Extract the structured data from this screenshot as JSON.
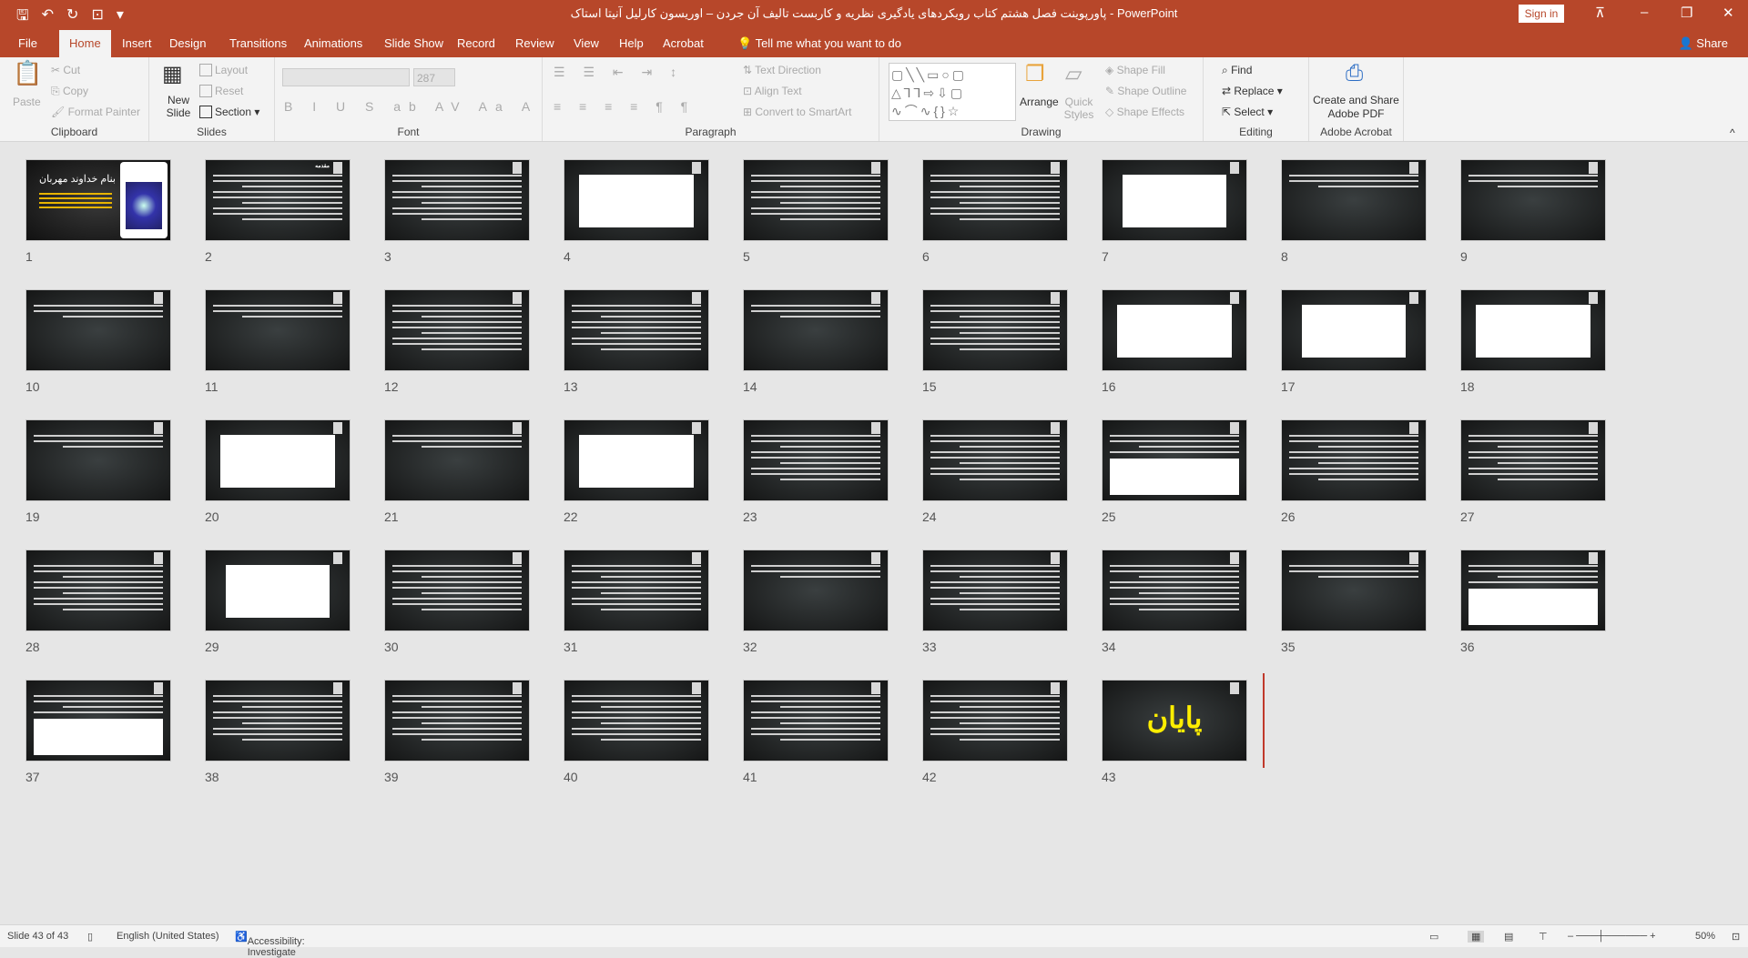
{
  "app": {
    "title": "پاورپوینت فصل هشتم کتاب رویکردهای یادگیری نظریه و کاربست تالیف آن جردن – اوریسون کارلیل آنیتا استاک  -  PowerPoint",
    "sign_in": "Sign in",
    "accent": "#b7472a"
  },
  "tabs": [
    "File",
    "Home",
    "Insert",
    "Design",
    "Transitions",
    "Animations",
    "Slide Show",
    "Record",
    "Review",
    "View",
    "Help",
    "Acrobat"
  ],
  "active_tab": "Home",
  "tell_me": "Tell me what you want to do",
  "share": "Share",
  "ribbon": {
    "clipboard": {
      "label": "Clipboard",
      "paste": "Paste",
      "cut": "Cut",
      "copy": "Copy",
      "format_painter": "Format Painter"
    },
    "slides": {
      "label": "Slides",
      "new_slide": "New Slide",
      "layout": "Layout",
      "reset": "Reset",
      "section": "Section"
    },
    "font": {
      "label": "Font",
      "font_size": "287"
    },
    "paragraph": {
      "label": "Paragraph",
      "text_direction": "Text Direction",
      "align_text": "Align Text",
      "convert": "Convert to SmartArt"
    },
    "drawing": {
      "label": "Drawing",
      "arrange": "Arrange",
      "quick_styles": "Quick Styles",
      "shape_fill": "Shape Fill",
      "shape_outline": "Shape Outline",
      "shape_effects": "Shape Effects"
    },
    "editing": {
      "label": "Editing",
      "find": "Find",
      "replace": "Replace",
      "select": "Select"
    },
    "acrobat": {
      "label": "Adobe Acrobat",
      "create": "Create and Share Adobe PDF"
    }
  },
  "slides": [
    {
      "n": "1",
      "kind": "title",
      "title": "بنام خداوند مهربان"
    },
    {
      "n": "2",
      "kind": "text",
      "title": "مقدمه"
    },
    {
      "n": "3",
      "kind": "text"
    },
    {
      "n": "4",
      "kind": "figure"
    },
    {
      "n": "5",
      "kind": "text"
    },
    {
      "n": "6",
      "kind": "text"
    },
    {
      "n": "7",
      "kind": "figure"
    },
    {
      "n": "8",
      "kind": "short"
    },
    {
      "n": "9",
      "kind": "short"
    },
    {
      "n": "10",
      "kind": "short"
    },
    {
      "n": "11",
      "kind": "short"
    },
    {
      "n": "12",
      "kind": "text"
    },
    {
      "n": "13",
      "kind": "text"
    },
    {
      "n": "14",
      "kind": "short"
    },
    {
      "n": "15",
      "kind": "text"
    },
    {
      "n": "16",
      "kind": "figure"
    },
    {
      "n": "17",
      "kind": "figure"
    },
    {
      "n": "18",
      "kind": "figure"
    },
    {
      "n": "19",
      "kind": "short"
    },
    {
      "n": "20",
      "kind": "figure"
    },
    {
      "n": "21",
      "kind": "short"
    },
    {
      "n": "22",
      "kind": "figure"
    },
    {
      "n": "23",
      "kind": "text"
    },
    {
      "n": "24",
      "kind": "text"
    },
    {
      "n": "25",
      "kind": "mixed"
    },
    {
      "n": "26",
      "kind": "text"
    },
    {
      "n": "27",
      "kind": "text"
    },
    {
      "n": "28",
      "kind": "text"
    },
    {
      "n": "29",
      "kind": "figure"
    },
    {
      "n": "30",
      "kind": "text"
    },
    {
      "n": "31",
      "kind": "text"
    },
    {
      "n": "32",
      "kind": "short"
    },
    {
      "n": "33",
      "kind": "text"
    },
    {
      "n": "34",
      "kind": "text"
    },
    {
      "n": "35",
      "kind": "short"
    },
    {
      "n": "36",
      "kind": "mixed"
    },
    {
      "n": "37",
      "kind": "mixed"
    },
    {
      "n": "38",
      "kind": "text"
    },
    {
      "n": "39",
      "kind": "text"
    },
    {
      "n": "40",
      "kind": "text"
    },
    {
      "n": "41",
      "kind": "text"
    },
    {
      "n": "42",
      "kind": "text"
    },
    {
      "n": "43",
      "kind": "end",
      "title": "پایان"
    }
  ],
  "status": {
    "slide": "Slide 43 of 43",
    "language": "English (United States)",
    "accessibility": "Accessibility: Investigate",
    "zoom": "50%"
  }
}
